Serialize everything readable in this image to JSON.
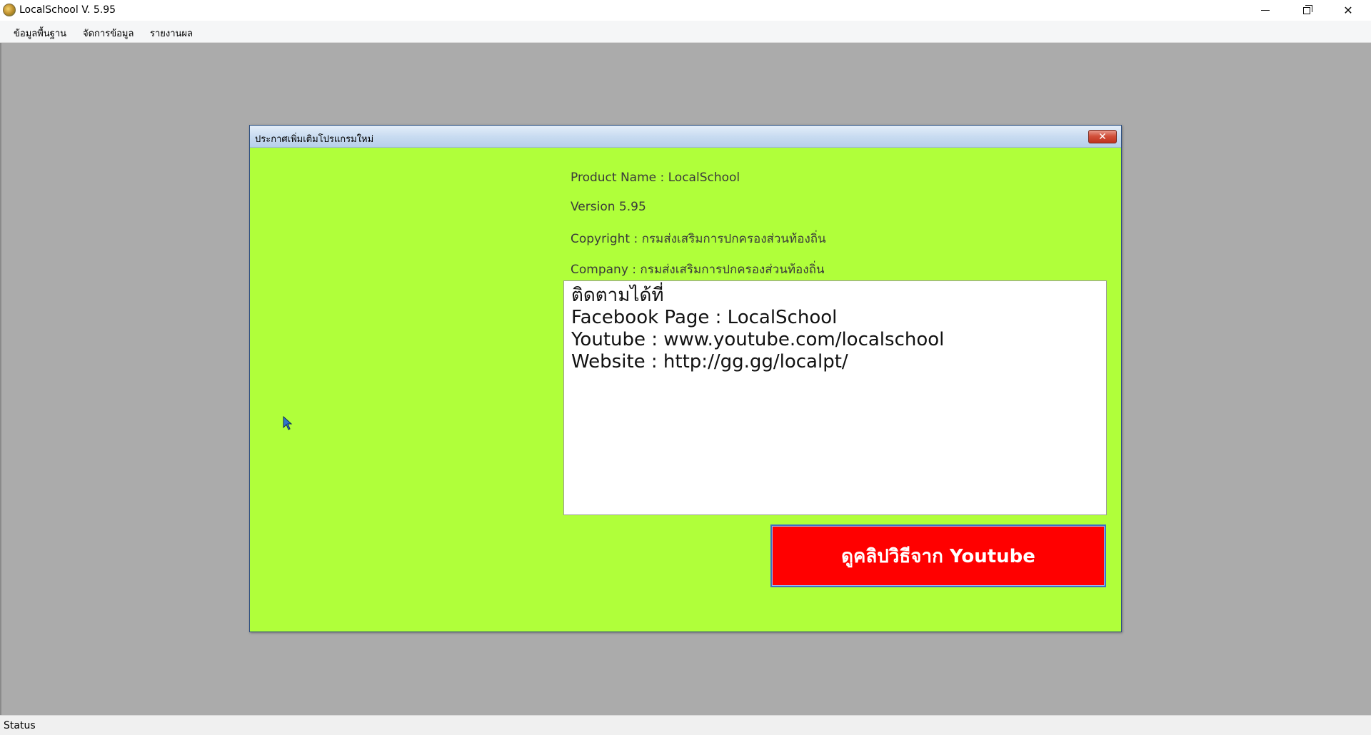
{
  "app": {
    "title": "LocalSchool V. 5.95"
  },
  "menu": {
    "items": [
      {
        "label": "ข้อมูลพื้นฐาน"
      },
      {
        "label": "จัดการข้อมูล"
      },
      {
        "label": "รายงานผล"
      }
    ]
  },
  "window_controls": {
    "minimize": "minimize-icon",
    "restore": "restore-icon",
    "close": "✕"
  },
  "dialog": {
    "title": "ประกาศเพิ่มเติมโปรแกรมใหม่",
    "close_label": "✕",
    "info": {
      "product": "Product Name : LocalSchool",
      "version": "Version 5.95",
      "copyright": "Copyright  :  กรมส่งเสริมการปกครองส่วนท้องถิ่น",
      "company": "Company : กรมส่งเสริมการปกครองส่วนท้องถิ่น"
    },
    "textbox": {
      "lines": [
        "ติดตามได้ที่",
        "Facebook Page : LocalSchool",
        "Youtube : www.youtube.com/localschool",
        "Website : http://gg.gg/localpt/"
      ]
    },
    "youtube_button_label": "ดูคลิปวิธีจาก Youtube"
  },
  "status": {
    "text": "Status"
  },
  "colors": {
    "dialog_bg": "#b0ff3a",
    "mdi_bg": "#ababab",
    "youtube_button_bg": "#ff0000"
  }
}
